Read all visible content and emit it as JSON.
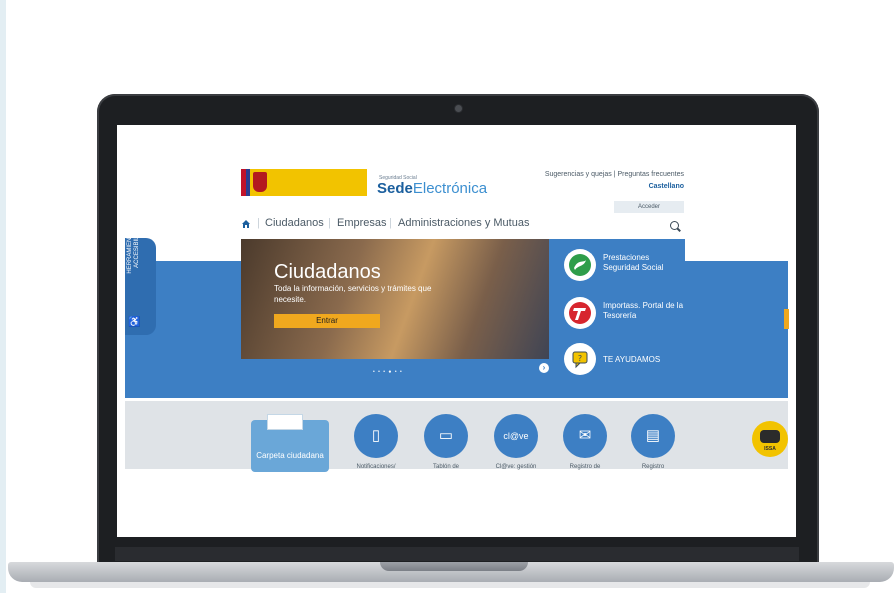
{
  "site": {
    "brand_sub": "Seguridad Social",
    "brand_bold": "Sede",
    "brand_light": "Electrónica",
    "top_links": "Sugerencias y quejas  |  Preguntas frecuentes",
    "language": "Castellano",
    "login_button": "Acceder",
    "nav": {
      "home_icon": "home-icon",
      "items": [
        "Ciudadanos",
        "Empresas",
        "Administraciones y Mutuas"
      ],
      "search_icon": "search-icon"
    }
  },
  "hero": {
    "title": "Ciudadanos",
    "subtitle": "Toda la información, servicios y trámites que necesite.",
    "button": "Entrar",
    "dots": "• • • ● • •"
  },
  "quick_links": [
    {
      "label": "Prestaciones Seguridad Social",
      "color": "#2e9d4a"
    },
    {
      "label": "Importass. Portal de la Tesorería",
      "color": "#d7262e"
    },
    {
      "label": "TE AYUDAMOS",
      "color": "#f2c300"
    }
  ],
  "accessibility": {
    "label": "HERRAMIENTAS DE ACCESIBILIDAD"
  },
  "services": {
    "folder_label": "Carpeta ciudadana",
    "items": [
      {
        "label": "Notificaciones/",
        "icon": "document-icon"
      },
      {
        "label": "Tablón de",
        "icon": "monitor-icon"
      },
      {
        "label": "Cl@ve: gestión",
        "icon": "clave-icon"
      },
      {
        "label": "Registro de",
        "icon": "mail-icon"
      },
      {
        "label": "Registro",
        "icon": "register-icon"
      }
    ],
    "clave_text": "cl@ve"
  },
  "assistant": {
    "label": "ISSA"
  },
  "colors": {
    "primary_blue": "#3d7fc4",
    "orange": "#f0a81e"
  }
}
